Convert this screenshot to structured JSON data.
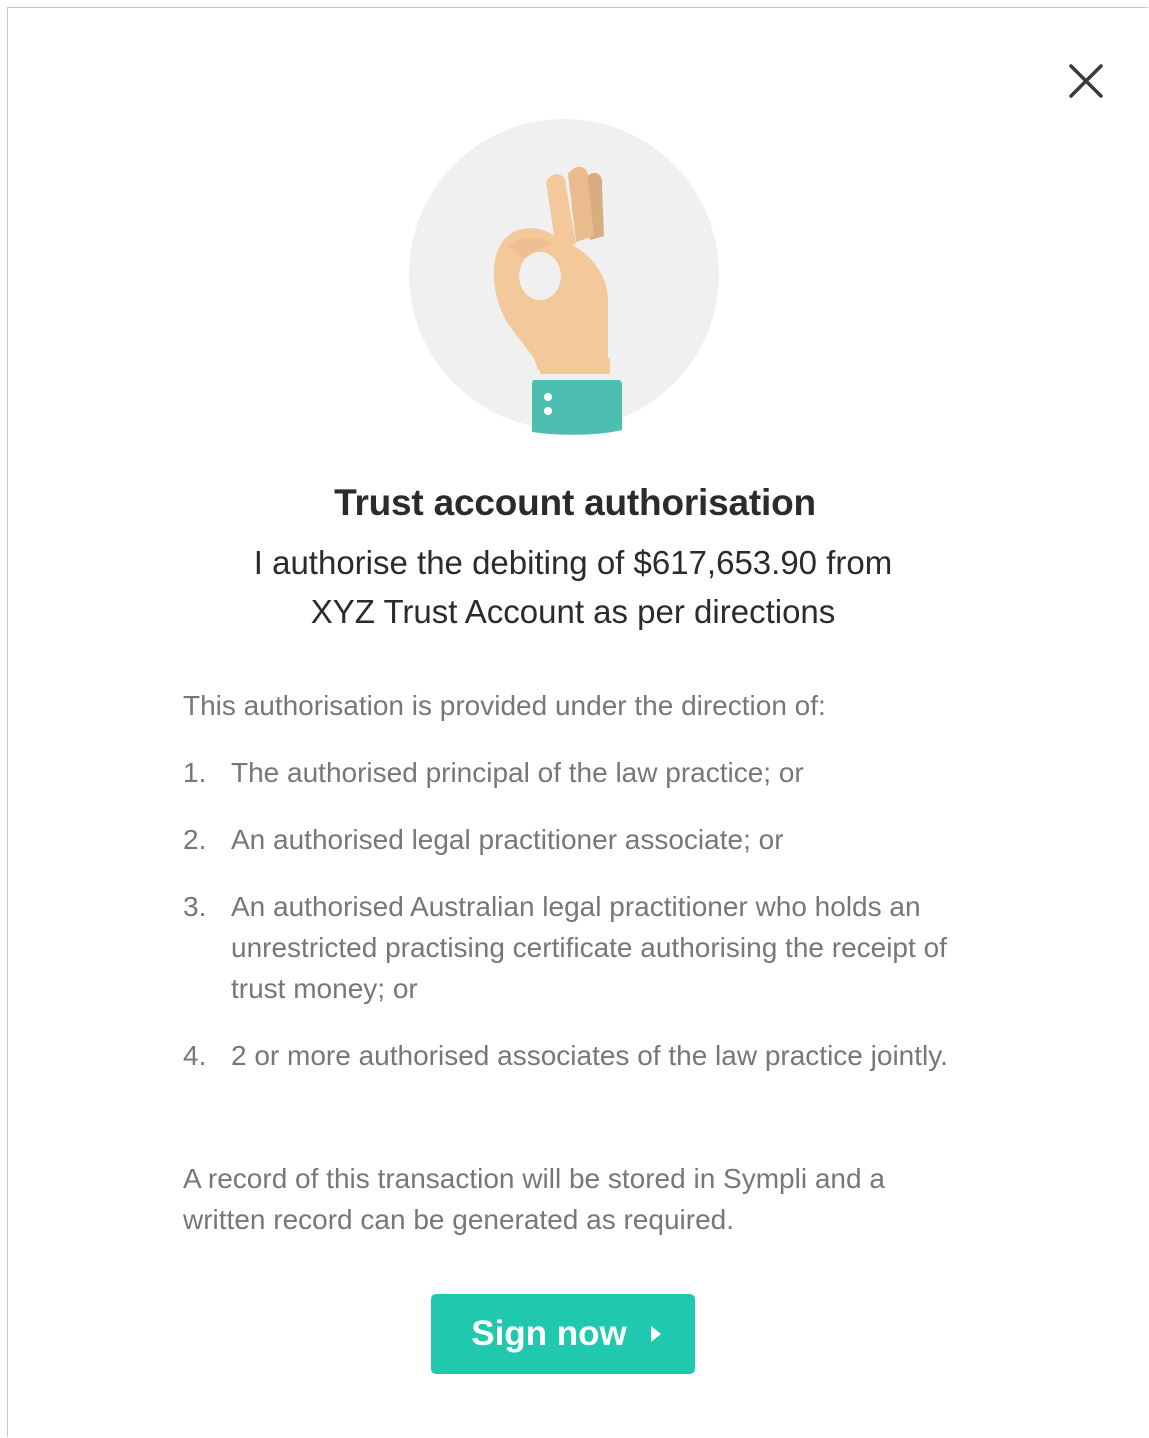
{
  "dialog": {
    "close_icon": "close-icon",
    "illustration_icon": "ok-hand-icon",
    "title": "Trust account authorisation",
    "subtitle_line1": "I authorise the debiting of $617,653.90 from",
    "subtitle_line2": "XYZ Trust Account as per directions",
    "intro": "This authorisation is provided under the direction of:",
    "list": [
      {
        "num": "1.",
        "text": "The authorised principal of the law practice; or"
      },
      {
        "num": "2.",
        "text": "An authorised legal practitioner associate; or"
      },
      {
        "num": "3.",
        "text": "An authorised Australian legal practitioner who holds an unrestricted practising certificate authorising the receipt of trust money; or"
      },
      {
        "num": "4.",
        "text": "2 or more authorised associates of the law practice jointly."
      }
    ],
    "footer_note": "A record of this transaction will be stored in Sympli and a written record can be generated as required.",
    "sign_button_label": "Sign now",
    "sign_button_icon": "chevron-right-icon"
  },
  "colors": {
    "accent": "#20c8ae",
    "cuff": "#4dbfb0",
    "skin": "#f3c99b",
    "circle": "#f0f0f0",
    "heading": "#2b2b2b",
    "body_text": "#777777"
  }
}
